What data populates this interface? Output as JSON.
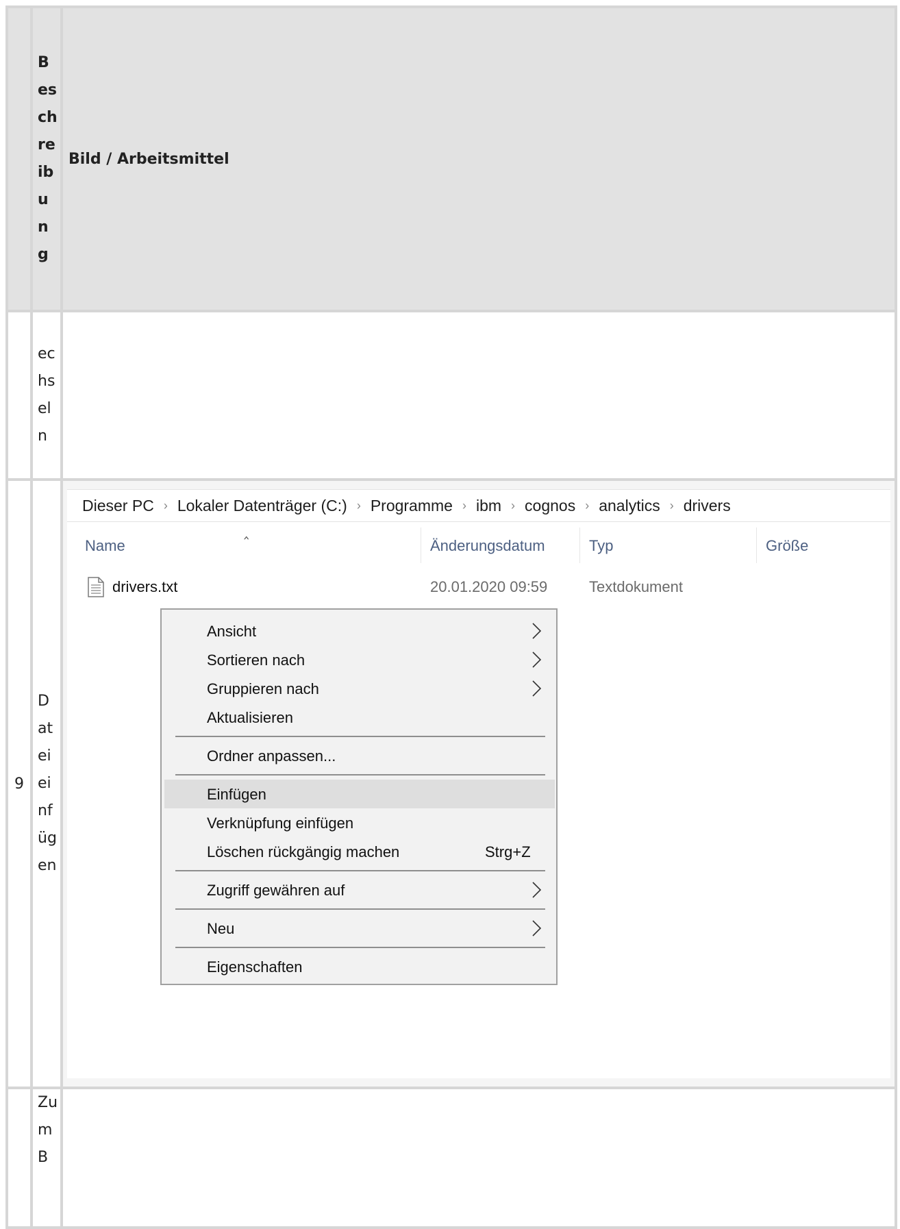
{
  "table": {
    "header": {
      "col2": "Beschreibung",
      "col3": "Bild / Arbeitsmittel"
    },
    "rows": [
      {
        "num": "",
        "desc": "echseln"
      },
      {
        "num": "9",
        "desc": "Dateieinfügen"
      },
      {
        "num": "",
        "desc": "ZumB"
      }
    ]
  },
  "explorer": {
    "breadcrumb": [
      "Dieser PC",
      "Lokaler Datenträger (C:)",
      "Programme",
      "ibm",
      "cognos",
      "analytics",
      "drivers"
    ],
    "columns": {
      "name": "Name",
      "date": "Änderungsdatum",
      "type": "Typ",
      "size": "Größe"
    },
    "file": {
      "name": "drivers.txt",
      "date": "20.01.2020 09:59",
      "type": "Textdokument",
      "icon": "text-file-icon"
    }
  },
  "context_menu": {
    "items": [
      {
        "label": "Ansicht",
        "submenu": true
      },
      {
        "label": "Sortieren nach",
        "submenu": true
      },
      {
        "label": "Gruppieren nach",
        "submenu": true
      },
      {
        "label": "Aktualisieren"
      },
      {
        "label": "Ordner anpassen..."
      },
      {
        "label": "Einfügen",
        "highlighted": true
      },
      {
        "label": "Verknüpfung einfügen"
      },
      {
        "label": "Löschen rückgängig machen",
        "shortcut": "Strg+Z"
      },
      {
        "label": "Zugriff gewähren auf",
        "submenu": true
      },
      {
        "label": "Neu",
        "submenu": true
      },
      {
        "label": "Eigenschaften"
      }
    ]
  }
}
